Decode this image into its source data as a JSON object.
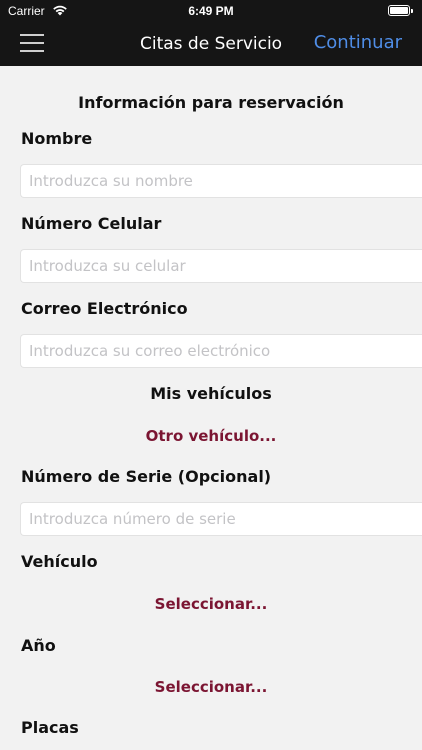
{
  "status_bar": {
    "carrier": "Carrier",
    "time": "6:49 PM"
  },
  "navbar": {
    "menu_icon": "hamburger-menu-icon",
    "title": "Citas de Servicio",
    "continue_label": "Continuar",
    "continue_color": "#4f8de6"
  },
  "form": {
    "section_title": "Información para reservación",
    "name": {
      "label": "Nombre",
      "placeholder": "Introduzca su nombre",
      "value": ""
    },
    "phone": {
      "label": "Número Celular",
      "placeholder": "Introduzca su celular",
      "value": ""
    },
    "email": {
      "label": "Correo Electrónico",
      "placeholder": "Introduzca su correo electrónico",
      "value": ""
    }
  },
  "vehicles": {
    "section_title": "Mis vehículos",
    "other_vehicle_label": "Otro vehículo...",
    "serial": {
      "label": "Número de Serie (Opcional)",
      "placeholder": "Introduzca número de serie",
      "value": ""
    },
    "vehicle": {
      "label": "Vehículo",
      "select_label": "Seleccionar..."
    },
    "year": {
      "label": "Año",
      "select_label": "Seleccionar..."
    },
    "plates": {
      "label": "Placas"
    }
  },
  "colors": {
    "accent_link": "#7b1532",
    "nav_background": "#151515",
    "page_background": "#f2f2f2"
  }
}
